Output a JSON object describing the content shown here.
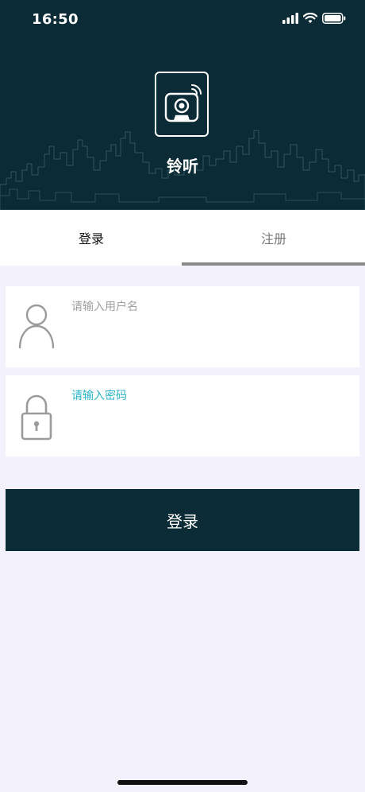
{
  "status_bar": {
    "time": "16:50"
  },
  "header": {
    "app_title": "铃听"
  },
  "tabs": [
    {
      "label": "登录",
      "active": true
    },
    {
      "label": "注册",
      "active": false
    }
  ],
  "form": {
    "username_placeholder": "请输入用户名",
    "password_placeholder": "请输入密码",
    "login_button_label": "登录"
  },
  "colors": {
    "header_bg": "#0b2b36",
    "page_bg": "#f2f1fc",
    "accent": "#2bb5c8",
    "indicator": "#8a8a8a"
  },
  "icons": [
    "signal-icon",
    "wifi-icon",
    "battery-icon",
    "camera-logo-icon",
    "user-icon",
    "lock-icon"
  ]
}
